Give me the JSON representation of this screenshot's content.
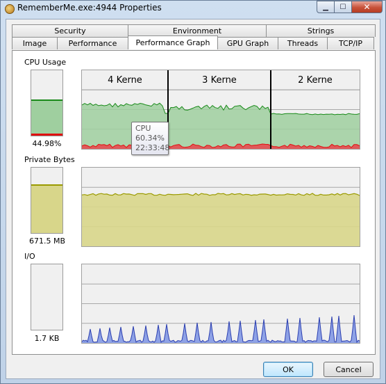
{
  "window": {
    "title": "RememberMe.exe:4944 Properties"
  },
  "caption": {
    "minimize": "▁",
    "maximize": "☐",
    "close": "✕"
  },
  "tabs": {
    "row_top": [
      "Security",
      "Environment",
      "Strings"
    ],
    "row_bottom": [
      "Image",
      "Performance",
      "Performance Graph",
      "GPU Graph",
      "Threads",
      "TCP/IP"
    ],
    "active": "Performance Graph"
  },
  "cpu": {
    "label": "CPU Usage",
    "value": "44.98%",
    "level_fraction": 0.53,
    "kernel_fraction": 0.03,
    "core_labels": [
      "4 Kerne",
      "3 Kerne",
      "2 Kerne"
    ],
    "tooltip": {
      "name": "CPU",
      "value": "60.34%",
      "time": "22:33:48"
    }
  },
  "private_bytes": {
    "label": "Private Bytes",
    "value": "671.5 MB",
    "level_fraction": 0.72
  },
  "io": {
    "label": "I/O",
    "value": "1.7  KB",
    "level_fraction": 0.0
  },
  "buttons": {
    "ok": "OK",
    "cancel": "Cancel"
  },
  "colors": {
    "cpu_fill": "#9fcf9f",
    "cpu_line": "#1a8a1a",
    "kernel_line": "#e01010",
    "memory_fill": "#d8d68a",
    "memory_line": "#9a9a00",
    "io_fill": "#8ea2e6",
    "io_line": "#2c3fb0"
  }
}
